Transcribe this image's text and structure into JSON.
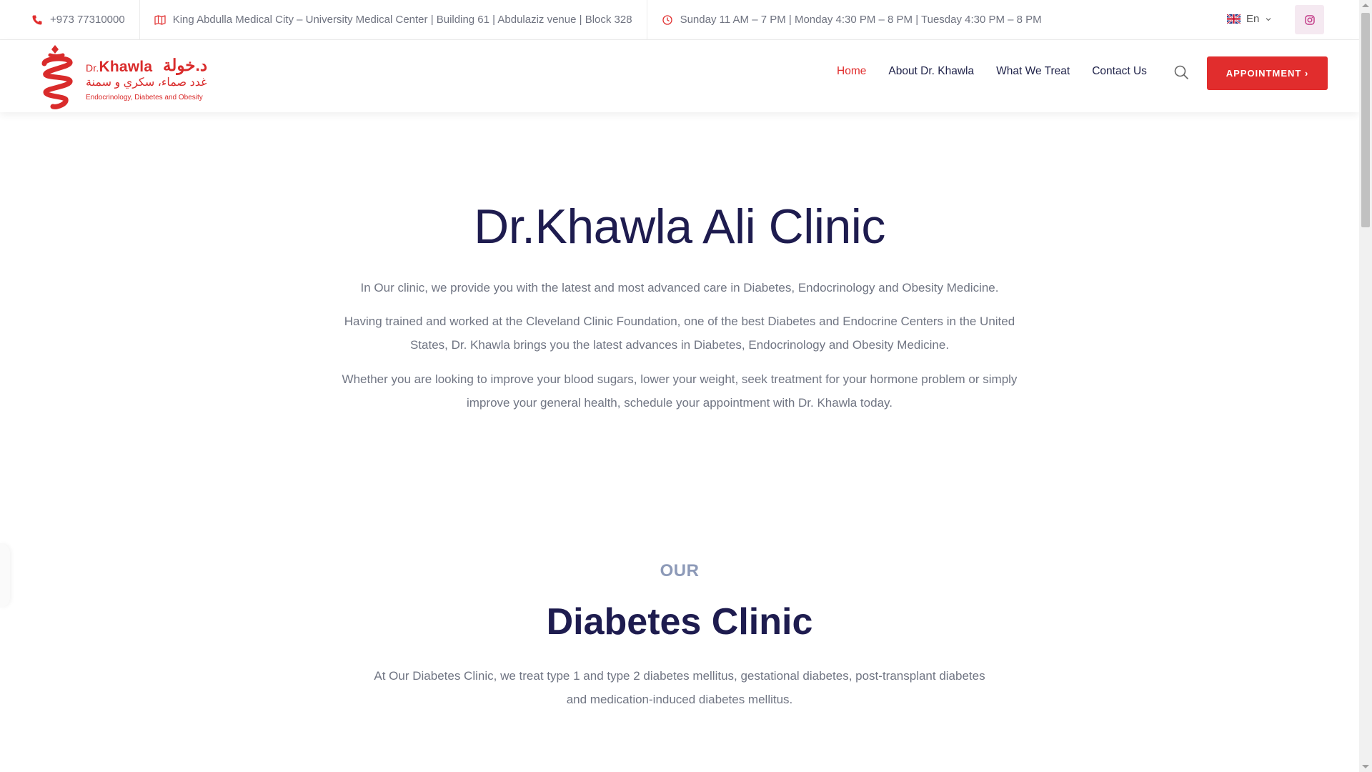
{
  "topbar": {
    "phone": "+973 77310000",
    "address": "King Abdulla Medical City – University Medical Center | Building 61 | Abdulaziz venue | Block 328",
    "hours": "Sunday 11 AM – 7 PM | Monday 4:30 PM – 8 PM | Tuesday 4:30 PM – 8 PM",
    "language": "En"
  },
  "logo": {
    "dr": "Dr.",
    "name_en": "Khawla",
    "name_ar": "د.خولة",
    "tagline_ar": "غدد صماء، سكري و سمنة",
    "subtitle": "Endocrinology, Diabetes and Obesity"
  },
  "nav": {
    "items": [
      "Home",
      "About Dr. Khawla",
      "What We Treat",
      "Contact Us"
    ],
    "appointment": "APPOINTMENT ›"
  },
  "hero": {
    "title": "Dr.Khawla Ali Clinic",
    "p1": "In Our clinic, we provide you with the latest and most advanced care in Diabetes, Endocrinology and Obesity Medicine.",
    "p2": "Having trained and worked at the Cleveland Clinic Foundation, one of the best Diabetes and Endocrine Centers in the United States, Dr. Khawla brings you the latest advances in Diabetes, Endocrinology and Obesity Medicine.",
    "p3": "Whether you are looking to improve your blood sugars, lower your weight, seek treatment for your hormone problem or simply improve your general health, schedule your appointment with Dr. Khawla today."
  },
  "section": {
    "eyebrow": "OUR",
    "title": "Diabetes Clinic",
    "text": "At Our Diabetes Clinic, we treat type 1 and type 2 diabetes mellitus, gestational diabetes, post-transplant diabetes and medication-induced diabetes mellitus."
  },
  "colors": {
    "accent": "#e12d2d",
    "heading": "#1e1c4f",
    "body": "#707583",
    "eyebrow": "#8d9ab8"
  },
  "icons": [
    "phone-icon",
    "map-icon",
    "clock-icon",
    "uk-flag-icon",
    "chevron-down-icon",
    "instagram-icon",
    "search-icon"
  ]
}
